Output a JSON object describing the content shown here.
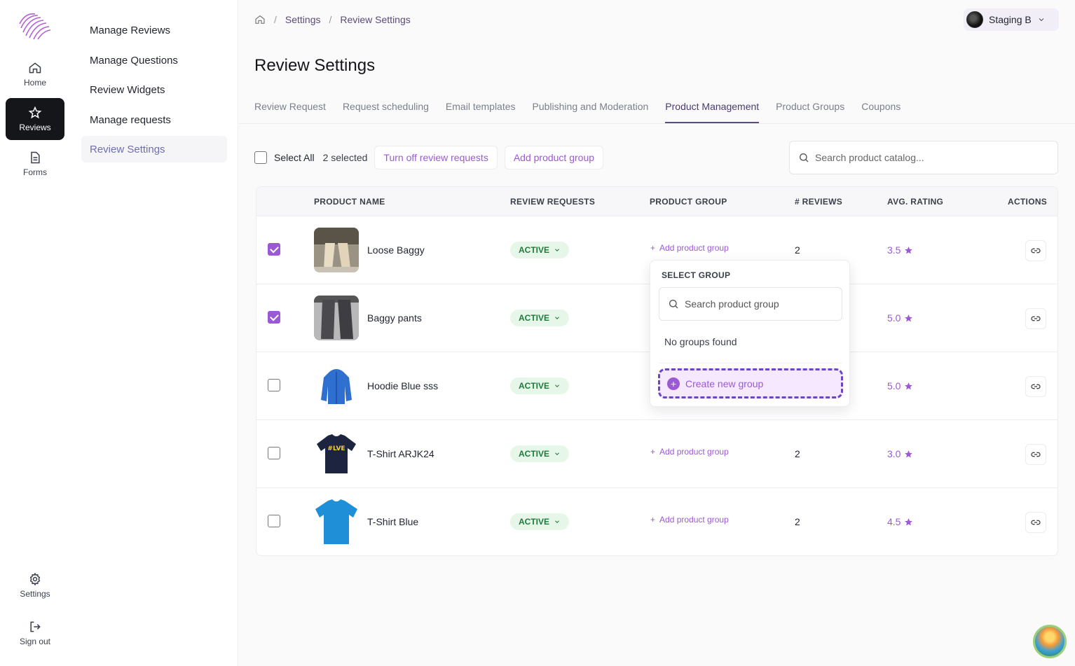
{
  "rail": {
    "items": [
      {
        "label": "Home",
        "icon": "home-icon"
      },
      {
        "label": "Reviews",
        "icon": "star-icon",
        "active": true
      },
      {
        "label": "Forms",
        "icon": "document-icon"
      }
    ],
    "bottom": [
      {
        "label": "Settings",
        "icon": "gear-icon"
      },
      {
        "label": "Sign out",
        "icon": "sign-out-icon"
      }
    ]
  },
  "subnav": {
    "items": [
      {
        "label": "Manage Reviews"
      },
      {
        "label": "Manage Questions"
      },
      {
        "label": "Review Widgets"
      },
      {
        "label": "Manage requests"
      },
      {
        "label": "Review Settings",
        "active": true
      }
    ]
  },
  "breadcrumb": {
    "items": [
      "Settings",
      "Review Settings"
    ]
  },
  "workspace": {
    "name": "Staging B"
  },
  "page": {
    "title": "Review Settings"
  },
  "tabs": [
    {
      "label": "Review Request"
    },
    {
      "label": "Request scheduling"
    },
    {
      "label": "Email templates"
    },
    {
      "label": "Publishing and Moderation"
    },
    {
      "label": "Product Management",
      "active": true
    },
    {
      "label": "Product Groups"
    },
    {
      "label": "Coupons"
    }
  ],
  "toolbar": {
    "select_all": "Select All",
    "selected_count": "2 selected",
    "turn_off": "Turn off review requests",
    "add_group": "Add product group",
    "search_placeholder": "Search product catalog..."
  },
  "table": {
    "headers": [
      "PRODUCT NAME",
      "REVIEW REQUESTS",
      "PRODUCT GROUP",
      "# REVIEWS",
      "AVG. RATING",
      "ACTIONS"
    ],
    "rows": [
      {
        "name": "Loose Baggy",
        "status": "ACTIVE",
        "group": "Add product group",
        "reviews": "2",
        "rating": "3.5",
        "checked": true
      },
      {
        "name": "Baggy pants",
        "status": "ACTIVE",
        "group": "",
        "reviews": "",
        "rating": "5.0",
        "checked": true
      },
      {
        "name": "Hoodie Blue sss",
        "status": "ACTIVE",
        "group": "",
        "reviews": "",
        "rating": "5.0",
        "checked": false
      },
      {
        "name": "T-Shirt ARJK24",
        "status": "ACTIVE",
        "group": "Add product group",
        "reviews": "2",
        "rating": "3.0",
        "checked": false
      },
      {
        "name": "T-Shirt Blue",
        "status": "ACTIVE",
        "group": "Add product group",
        "reviews": "2",
        "rating": "4.5",
        "checked": false
      }
    ]
  },
  "popover": {
    "title": "SELECT GROUP",
    "search_placeholder": "Search product group",
    "empty": "No groups found",
    "create": "Create new group"
  },
  "colors": {
    "accent": "#9b59d6",
    "active_rail": "#15161a",
    "status_bg": "#e6f7ea",
    "status_fg": "#1f7a3a"
  }
}
